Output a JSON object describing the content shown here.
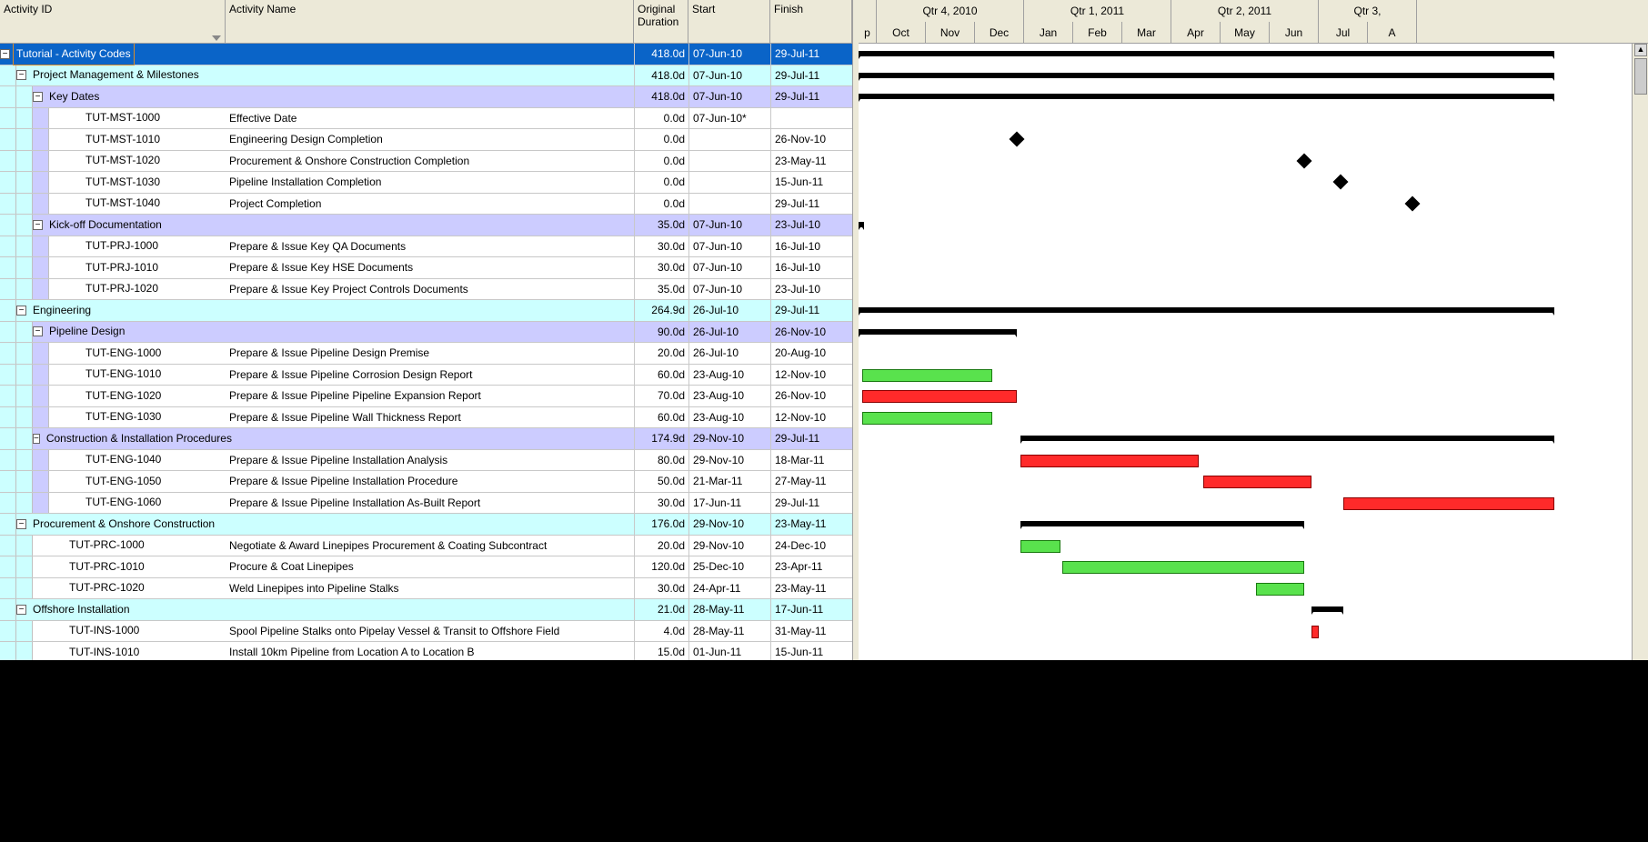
{
  "columns": {
    "id": "Activity ID",
    "name": "Activity Name",
    "dur": "Original Duration",
    "start": "Start",
    "finish": "Finish"
  },
  "timeline": {
    "quarters": [
      {
        "label": "",
        "months": [
          "p"
        ]
      },
      {
        "label": "Qtr 4, 2010",
        "months": [
          "Oct",
          "Nov",
          "Dec"
        ]
      },
      {
        "label": "Qtr 1, 2011",
        "months": [
          "Jan",
          "Feb",
          "Mar"
        ]
      },
      {
        "label": "Qtr 2, 2011",
        "months": [
          "Apr",
          "May",
          "Jun"
        ]
      },
      {
        "label": "Qtr 3,",
        "months": [
          "Jul",
          "A"
        ]
      }
    ],
    "monthWidth": 54,
    "firstPartial": 20
  },
  "stripeColors": [
    "#ccffff",
    "#ccffff",
    "#ccccff",
    "#ccccff"
  ],
  "rows": [
    {
      "type": "summary0",
      "level": 0,
      "toggle": "-",
      "id": "Tutorial - Activity Codes",
      "name": "",
      "dur": "418.0d",
      "start": "07-Jun-10",
      "finish": "29-Jul-11",
      "bar": {
        "kind": "summary",
        "s": -3,
        "e": 13.8
      },
      "selected": true
    },
    {
      "type": "summary1",
      "level": 1,
      "toggle": "-",
      "id": "Project Management & Milestones",
      "name": "",
      "dur": "418.0d",
      "start": "07-Jun-10",
      "finish": "29-Jul-11",
      "bar": {
        "kind": "summary",
        "s": -3,
        "e": 13.8
      }
    },
    {
      "type": "summary2",
      "level": 2,
      "toggle": "-",
      "id": "Key Dates",
      "name": "",
      "dur": "418.0d",
      "start": "07-Jun-10",
      "finish": "29-Jul-11",
      "bar": {
        "kind": "summary",
        "s": -3,
        "e": 13.8
      }
    },
    {
      "type": "activity",
      "level": 3,
      "id": "TUT-MST-1000",
      "name": "Effective Date",
      "dur": "0.0d",
      "start": "07-Jun-10*",
      "finish": ""
    },
    {
      "type": "activity",
      "level": 3,
      "id": "TUT-MST-1010",
      "name": "Engineering Design Completion",
      "dur": "0.0d",
      "start": "",
      "finish": "26-Nov-10",
      "bar": {
        "kind": "milestone",
        "s": 2.85
      }
    },
    {
      "type": "activity",
      "level": 3,
      "id": "TUT-MST-1020",
      "name": "Procurement & Onshore Construction Completion",
      "dur": "0.0d",
      "start": "",
      "finish": "23-May-11",
      "bar": {
        "kind": "milestone",
        "s": 8.7
      }
    },
    {
      "type": "activity",
      "level": 3,
      "id": "TUT-MST-1030",
      "name": "Pipeline Installation Completion",
      "dur": "0.0d",
      "start": "",
      "finish": "15-Jun-11",
      "bar": {
        "kind": "milestone",
        "s": 9.45
      }
    },
    {
      "type": "activity",
      "level": 3,
      "id": "TUT-MST-1040",
      "name": "Project Completion",
      "dur": "0.0d",
      "start": "",
      "finish": "29-Jul-11",
      "bar": {
        "kind": "milestone",
        "s": 10.9
      }
    },
    {
      "type": "summary2",
      "level": 2,
      "toggle": "-",
      "id": "Kick-off Documentation",
      "name": "",
      "dur": "35.0d",
      "start": "07-Jun-10",
      "finish": "23-Jul-10",
      "bar": {
        "kind": "summary",
        "s": -3,
        "e": -1
      }
    },
    {
      "type": "activity",
      "level": 3,
      "id": "TUT-PRJ-1000",
      "name": "Prepare & Issue Key QA Documents",
      "dur": "30.0d",
      "start": "07-Jun-10",
      "finish": "16-Jul-10"
    },
    {
      "type": "activity",
      "level": 3,
      "id": "TUT-PRJ-1010",
      "name": "Prepare & Issue Key HSE Documents",
      "dur": "30.0d",
      "start": "07-Jun-10",
      "finish": "16-Jul-10"
    },
    {
      "type": "activity",
      "level": 3,
      "id": "TUT-PRJ-1020",
      "name": "Prepare & Issue Key Project Controls Documents",
      "dur": "35.0d",
      "start": "07-Jun-10",
      "finish": "23-Jul-10"
    },
    {
      "type": "summary1",
      "level": 1,
      "toggle": "-",
      "id": "Engineering",
      "name": "",
      "dur": "264.9d",
      "start": "26-Jul-10",
      "finish": "29-Jul-11",
      "bar": {
        "kind": "summary",
        "s": -2,
        "e": 13.8
      }
    },
    {
      "type": "summary2",
      "level": 2,
      "toggle": "-",
      "id": "Pipeline Design",
      "name": "",
      "dur": "90.0d",
      "start": "26-Jul-10",
      "finish": "26-Nov-10",
      "bar": {
        "kind": "summary",
        "s": -2,
        "e": 2.85
      }
    },
    {
      "type": "activity",
      "level": 3,
      "id": "TUT-ENG-1000",
      "name": "Prepare & Issue Pipeline Design Premise",
      "dur": "20.0d",
      "start": "26-Jul-10",
      "finish": "20-Aug-10"
    },
    {
      "type": "activity",
      "level": 3,
      "id": "TUT-ENG-1010",
      "name": "Prepare & Issue Pipeline Corrosion Design Report",
      "dur": "60.0d",
      "start": "23-Aug-10",
      "finish": "12-Nov-10",
      "bar": {
        "kind": "green",
        "s": -0.3,
        "e": 2.35
      }
    },
    {
      "type": "activity",
      "level": 3,
      "id": "TUT-ENG-1020",
      "name": "Prepare & Issue Pipeline Pipeline Expansion Report",
      "dur": "70.0d",
      "start": "23-Aug-10",
      "finish": "26-Nov-10",
      "bar": {
        "kind": "red",
        "s": -0.3,
        "e": 2.85
      }
    },
    {
      "type": "activity",
      "level": 3,
      "id": "TUT-ENG-1030",
      "name": "Prepare & Issue Pipeline Wall Thickness Report",
      "dur": "60.0d",
      "start": "23-Aug-10",
      "finish": "12-Nov-10",
      "bar": {
        "kind": "green",
        "s": -0.3,
        "e": 2.35
      }
    },
    {
      "type": "summary2",
      "level": 2,
      "toggle": "-",
      "id": "Construction & Installation Procedures",
      "name": "",
      "dur": "174.9d",
      "start": "29-Nov-10",
      "finish": "29-Jul-11",
      "bar": {
        "kind": "summary",
        "s": 2.93,
        "e": 13.8
      }
    },
    {
      "type": "activity",
      "level": 3,
      "id": "TUT-ENG-1040",
      "name": "Prepare & Issue Pipeline Installation Analysis",
      "dur": "80.0d",
      "start": "29-Nov-10",
      "finish": "18-Mar-11",
      "bar": {
        "kind": "red",
        "s": 2.93,
        "e": 6.55
      }
    },
    {
      "type": "activity",
      "level": 3,
      "id": "TUT-ENG-1050",
      "name": "Prepare & Issue Pipeline Installation Procedure",
      "dur": "50.0d",
      "start": "21-Mar-11",
      "finish": "27-May-11",
      "bar": {
        "kind": "red",
        "s": 6.65,
        "e": 8.85
      }
    },
    {
      "type": "activity",
      "level": 3,
      "id": "TUT-ENG-1060",
      "name": "Prepare & Issue Pipeline Installation As-Built Report",
      "dur": "30.0d",
      "start": "17-Jun-11",
      "finish": "29-Jul-11",
      "bar": {
        "kind": "red",
        "s": 9.5,
        "e": 13.8
      }
    },
    {
      "type": "summary1",
      "level": 1,
      "toggle": "-",
      "id": "Procurement & Onshore Construction",
      "name": "",
      "dur": "176.0d",
      "start": "29-Nov-10",
      "finish": "23-May-11",
      "bar": {
        "kind": "summary",
        "s": 2.93,
        "e": 8.7
      }
    },
    {
      "type": "activity",
      "level": 2,
      "id": "TUT-PRC-1000",
      "name": "Negotiate & Award Linepipes Procurement & Coating Subcontract",
      "dur": "20.0d",
      "start": "29-Nov-10",
      "finish": "24-Dec-10",
      "bar": {
        "kind": "green",
        "s": 2.93,
        "e": 3.75
      }
    },
    {
      "type": "activity",
      "level": 2,
      "id": "TUT-PRC-1010",
      "name": "Procure & Coat Linepipes",
      "dur": "120.0d",
      "start": "25-Dec-10",
      "finish": "23-Apr-11",
      "bar": {
        "kind": "green",
        "s": 3.78,
        "e": 8.7
      }
    },
    {
      "type": "activity",
      "level": 2,
      "id": "TUT-PRC-1020",
      "name": "Weld Linepipes into Pipeline Stalks",
      "dur": "30.0d",
      "start": "24-Apr-11",
      "finish": "23-May-11",
      "bar": {
        "kind": "green",
        "s": 7.73,
        "e": 8.7
      }
    },
    {
      "type": "summary1",
      "level": 1,
      "toggle": "-",
      "id": "Offshore Installation",
      "name": "",
      "dur": "21.0d",
      "start": "28-May-11",
      "finish": "17-Jun-11",
      "bar": {
        "kind": "summary",
        "s": 8.85,
        "e": 9.5
      }
    },
    {
      "type": "activity",
      "level": 2,
      "id": "TUT-INS-1000",
      "name": "Spool Pipeline Stalks onto Pipelay Vessel & Transit to Offshore Field",
      "dur": "4.0d",
      "start": "28-May-11",
      "finish": "31-May-11",
      "bar": {
        "kind": "red",
        "s": 8.85,
        "e": 9.0
      }
    },
    {
      "type": "activity",
      "level": 2,
      "id": "TUT-INS-1010",
      "name": "Install 10km Pipeline from Location A to Location B",
      "dur": "15.0d",
      "start": "01-Jun-11",
      "finish": "15-Jun-11"
    }
  ]
}
